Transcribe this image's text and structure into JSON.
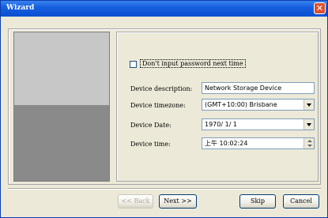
{
  "window": {
    "title": "Wizard",
    "close_glyph": "✕"
  },
  "checkbox": {
    "label": "Don't input password next time",
    "checked": false
  },
  "form": {
    "description": {
      "label": "Device description:",
      "value": "Network Storage Device"
    },
    "timezone": {
      "label": "Device timezone:",
      "value": "(GMT+10:00) Brisbane"
    },
    "date": {
      "label": "Device Date:",
      "value": "1970/ 1/ 1"
    },
    "time": {
      "label": "Device time:",
      "value": "上午 10:02:24"
    }
  },
  "buttons": {
    "back": "<< Back",
    "next": "Next >>",
    "skip": "Skip",
    "cancel": "Cancel"
  },
  "colors": {
    "titlebar": "#0a4fd0",
    "face": "#ece9d8",
    "close": "#d7522f"
  }
}
